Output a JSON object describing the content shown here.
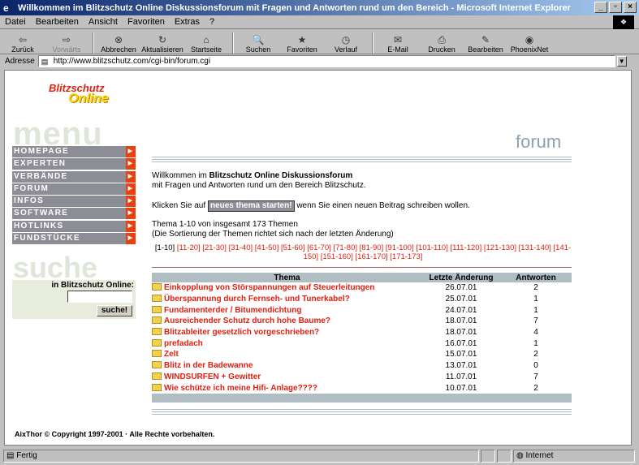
{
  "window": {
    "title": "Willkommen im Blitzschutz Online Diskussionsforum mit Fragen und Antworten rund um den Bereich - Microsoft Internet Explorer",
    "minimize": "_",
    "maximize": "▫",
    "close": "×"
  },
  "menu": [
    "Datei",
    "Bearbeiten",
    "Ansicht",
    "Favoriten",
    "Extras",
    "?"
  ],
  "toolbar": [
    {
      "label": "Zurück",
      "icon": "⇦",
      "enabled": true
    },
    {
      "label": "Vorwärts",
      "icon": "⇨",
      "enabled": false
    },
    {
      "label": "Abbrechen",
      "icon": "⊗",
      "enabled": true
    },
    {
      "label": "Aktualisieren",
      "icon": "↻",
      "enabled": true
    },
    {
      "label": "Startseite",
      "icon": "⌂",
      "enabled": true
    },
    {
      "label": "Suchen",
      "icon": "🔍",
      "enabled": true
    },
    {
      "label": "Favoriten",
      "icon": "★",
      "enabled": true
    },
    {
      "label": "Verlauf",
      "icon": "◷",
      "enabled": true
    },
    {
      "label": "E-Mail",
      "icon": "✉",
      "enabled": true
    },
    {
      "label": "Drucken",
      "icon": "⎙",
      "enabled": true
    },
    {
      "label": "Bearbeiten",
      "icon": "✎",
      "enabled": true
    },
    {
      "label": "PhoenixNet",
      "icon": "◉",
      "enabled": true
    }
  ],
  "address": {
    "label": "Adresse",
    "url": "http://www.blitzschutz.com/cgi-bin/forum.cgi"
  },
  "site": {
    "brand_top": "Blitzschutz",
    "brand_bottom": "Online",
    "menu_word": "menu",
    "suche_word": "suche",
    "forum_word": "forum"
  },
  "nav": [
    "HOMEPAGE",
    "EXPERTEN",
    "VERBÄNDE",
    "FORUM",
    "INFOS",
    "SOFTWARE",
    "HOTLINKS",
    "FUNDSTÜCKE"
  ],
  "search": {
    "label": "in Blitzschutz Online:",
    "button": "suche!",
    "value": ""
  },
  "intro": {
    "line1_pre": "Willkommen im ",
    "line1_bold": "Blitzschutz Online Diskussionsforum",
    "line2": "mit Fragen und Antworten rund um den Bereich Blitzschutz.",
    "click_pre": "Klicken Sie auf",
    "new_topic": "neues thema starten!",
    "click_post": "wenn Sie einen neuen Beitrag schreiben wollen.",
    "count": "Thema 1-10 von insgesamt 173 Themen",
    "sort": "(Die Sortierung der Themen richtet sich nach der letzten Änderung)"
  },
  "pages": {
    "current": "[1-10]",
    "links": [
      "[11-20]",
      "[21-30]",
      "[31-40]",
      "[41-50]",
      "[51-60]",
      "[61-70]",
      "[71-80]",
      "[81-90]",
      "[91-100]",
      "[101-110]",
      "[111-120]",
      "[121-130]",
      "[131-140]",
      "[141-150]",
      "[151-160]",
      "[161-170]",
      "[171-173]"
    ]
  },
  "table": {
    "headers": [
      "Thema",
      "Letzte Änderung",
      "Antworten"
    ],
    "rows": [
      {
        "topic": "Einkopplung von Störspannungen auf Steuerleitungen",
        "date": "26.07.01",
        "answers": "2"
      },
      {
        "topic": "Überspannung durch Fernseh- und Tunerkabel?",
        "date": "25.07.01",
        "answers": "1"
      },
      {
        "topic": "Fundamenterder / Bitumendichtung",
        "date": "24.07.01",
        "answers": "1"
      },
      {
        "topic": "Ausreichender Schutz durch hohe Baume?",
        "date": "18.07.01",
        "answers": "7"
      },
      {
        "topic": "Blitzableiter gesetzlich vorgeschrieben?",
        "date": "18.07.01",
        "answers": "4"
      },
      {
        "topic": "prefadach",
        "date": "16.07.01",
        "answers": "1"
      },
      {
        "topic": "Zelt",
        "date": "15.07.01",
        "answers": "2"
      },
      {
        "topic": "Blitz in der Badewanne",
        "date": "13.07.01",
        "answers": "0"
      },
      {
        "topic": "WINDSURFEN + Gewitter",
        "date": "11.07.01",
        "answers": "7"
      },
      {
        "topic": "Wie schütze ich meine Hifi- Anlage????",
        "date": "10.07.01",
        "answers": "2"
      }
    ]
  },
  "copyright": "AixThor © Copyright 1997-2001 · Alle Rechte vorbehalten.",
  "status": {
    "text": "Fertig",
    "zone": "Internet"
  }
}
